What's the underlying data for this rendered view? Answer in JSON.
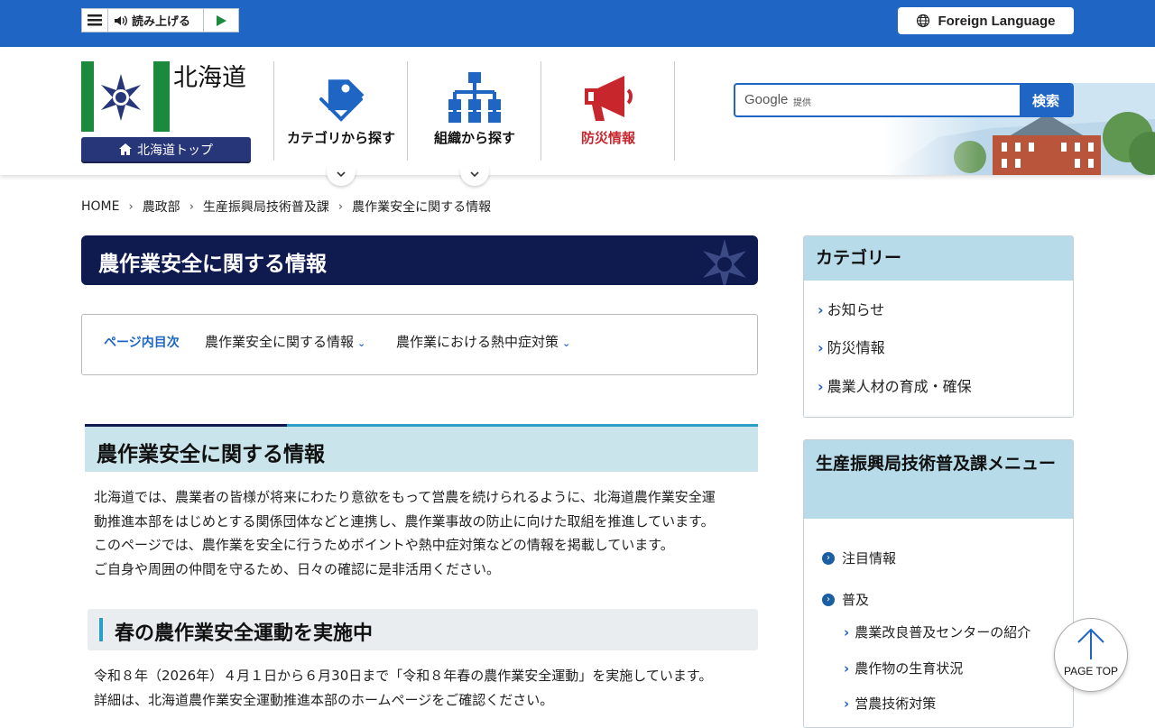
{
  "toolbar": {
    "read_aloud": "読み上げる",
    "foreign_language": "Foreign Language"
  },
  "header": {
    "site_name": "北海道",
    "top_link": "北海道トップ",
    "nav": [
      {
        "label": "カテゴリから探す",
        "icon": "tag-icon",
        "color": "#1f66c4"
      },
      {
        "label": "組織から探す",
        "icon": "org-chart-icon",
        "color": "#1f66c4"
      },
      {
        "label": "防災情報",
        "icon": "megaphone-icon",
        "color": "#c8262d"
      }
    ],
    "search": {
      "brand": "Google",
      "provided": "提供",
      "button": "検索"
    }
  },
  "breadcrumb": [
    "HOME",
    "農政部",
    "生産振興局技術普及課",
    "農作業安全に関する情報"
  ],
  "page_title": "農作業安全に関する情報",
  "toc": {
    "heading": "ページ内目次",
    "items": [
      "農作業安全に関する情報",
      "農作業における熱中症対策"
    ]
  },
  "main": {
    "section1_title": "農作業安全に関する情報",
    "section1_lines": [
      "北海道では、農業者の皆様が将来にわたり意欲をもって営農を続けられるように、北海道農作業安全運",
      "動推進本部をはじめとする関係団体などと連携し、農作業事故の防止に向けた取組を推進しています。",
      "このページでは、農作業を安全に行うためポイントや熱中症対策などの情報を掲載しています。",
      "ご自身や周囲の仲間を守るため、日々の確認に是非活用ください。"
    ],
    "section2_title": "春の農作業安全運動を実施中",
    "section2_lines": [
      "令和８年（2026年）４月１日から６月30日まで「令和８年春の農作業安全運動」を実施しています。",
      "詳細は、北海道農作業安全運動推進本部のホームページをご確認ください。"
    ]
  },
  "sidebar": {
    "category_title": "カテゴリー",
    "categories": [
      "お知らせ",
      "防災情報",
      "農業人材の育成・確保"
    ],
    "menu_title": "生産振興局技術普及課メニュー",
    "menu_items": [
      "注目情報",
      "普及"
    ],
    "menu_sub_items": [
      "農業改良普及センターの紹介",
      "農作物の生育状況",
      "営農技術対策"
    ]
  },
  "page_top": "PAGE TOP",
  "colors": {
    "brand_blue": "#1f66c4",
    "navy": "#0f1a4f",
    "disaster_red": "#c8262d",
    "logo_green": "#1c8a3c"
  }
}
